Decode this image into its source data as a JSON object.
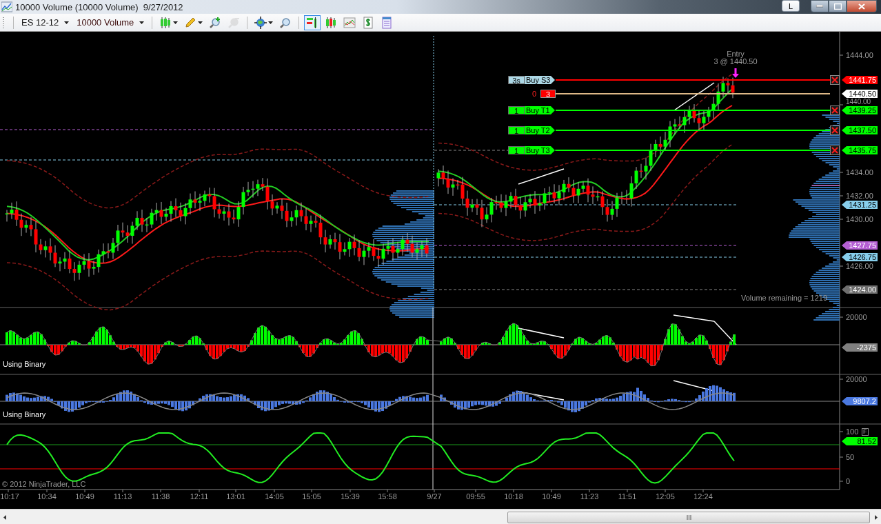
{
  "window": {
    "title": "10000 Volume (10000 Volume)  9/27/2012",
    "link_button": "L"
  },
  "toolbar": {
    "instrument": "ES 12-12",
    "period": "10000 Volume",
    "tools": [
      {
        "kind": "bar-style",
        "selected": false,
        "disabled": false
      },
      {
        "kind": "drawing",
        "selected": false,
        "disabled": false
      },
      {
        "kind": "zoom-in",
        "selected": false,
        "disabled": false
      },
      {
        "kind": "zoom-out",
        "selected": false,
        "disabled": true
      },
      {
        "kind": "crosshair",
        "selected": false,
        "disabled": false
      },
      {
        "kind": "properties",
        "selected": false,
        "disabled": false
      },
      {
        "kind": "chart-trader",
        "selected": true,
        "disabled": false
      },
      {
        "kind": "bars",
        "selected": false,
        "disabled": false
      },
      {
        "kind": "indicators",
        "selected": false,
        "disabled": false
      },
      {
        "kind": "strategies",
        "selected": false,
        "disabled": false
      },
      {
        "kind": "data-box",
        "selected": false,
        "disabled": false
      }
    ]
  },
  "price_panel": {
    "entry": {
      "title": "Entry",
      "detail": "3 @ 1440.50"
    },
    "orders": [
      {
        "kind": "stop",
        "quantity": "3s",
        "label": "Buy S3",
        "price": "1441.75"
      },
      {
        "kind": "position",
        "quantity": "0",
        "label": "3",
        "price": "1440.50"
      },
      {
        "kind": "target",
        "quantity": "1",
        "label": "Buy T1",
        "price": "1439.25"
      },
      {
        "kind": "target",
        "quantity": "1",
        "label": "Buy T2",
        "price": "1437.50"
      },
      {
        "kind": "target",
        "quantity": "1",
        "label": "Buy T3",
        "price": "1435.75"
      }
    ],
    "axis_ticks": [
      "1444.00",
      "1440.00",
      "1434.00",
      "1432.00",
      "1430.00",
      "1426.00"
    ],
    "markers": [
      {
        "price": "1431.25",
        "color": "#87ceeb"
      },
      {
        "price": "1427.75",
        "color": "#b55fd3"
      },
      {
        "price": "1426.75",
        "color": "#87ceeb"
      },
      {
        "price": "1424.00",
        "color": "#6e6e6e"
      }
    ],
    "volume_note": "Volume remaining = 1219"
  },
  "indicator_panels": [
    {
      "label": "Using Binary",
      "ticks": [
        "20000"
      ],
      "reading": "-2375",
      "color": "#808080"
    },
    {
      "label": "Using Binary",
      "ticks": [
        "20000"
      ],
      "reading": "9807.2",
      "color": "#4a78e0"
    },
    {
      "ticks": [
        "100",
        "50",
        "0"
      ],
      "reading": "81.52",
      "color": "#00ff00",
      "flag": "F"
    }
  ],
  "copyright": "© 2012 NinjaTrader, LLC",
  "time_axis": [
    "10:17",
    "10:34",
    "10:49",
    "11:13",
    "11:38",
    "12:11",
    "13:01",
    "14:05",
    "15:05",
    "15:39",
    "15:58",
    "9/27",
    "09:55",
    "10:18",
    "10:49",
    "11:23",
    "11:51",
    "12:05",
    "12:24"
  ]
}
